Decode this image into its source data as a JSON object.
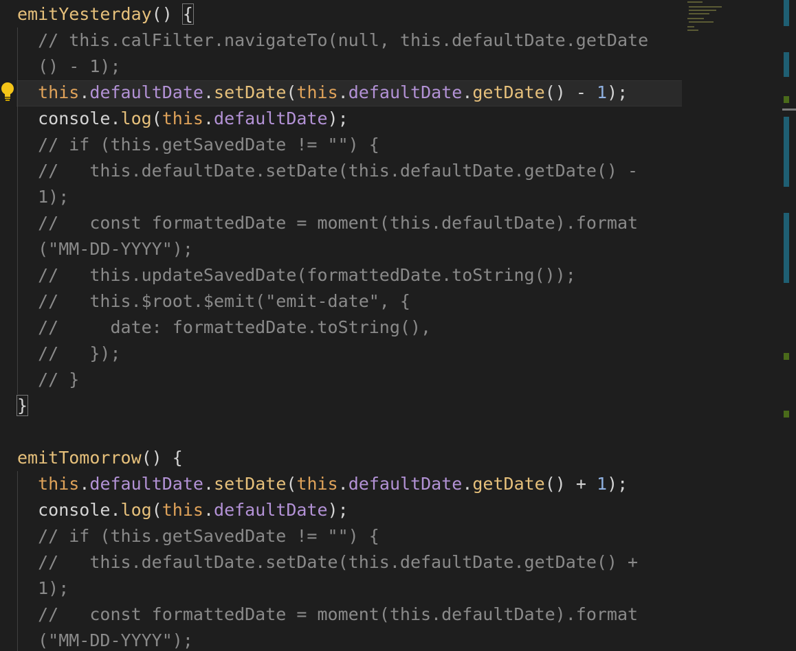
{
  "editor": {
    "theme_colors": {
      "background": "#1e1e1e",
      "function": "#e6c07b",
      "keyword_this": "#e0a35a",
      "property": "#b392d6",
      "number": "#8fb0e0",
      "comment": "#8a8a8a",
      "plain": "#d4d4d4"
    },
    "lightbulb_icon": "lightbulb-icon",
    "lines": [
      {
        "segments": [
          {
            "t": "emitYesterday",
            "c": "fn"
          },
          {
            "t": "() ",
            "c": "plain"
          },
          {
            "t": "{",
            "c": "plain",
            "match": true
          }
        ]
      },
      {
        "segments": [
          {
            "t": "  // this.calFilter.navigateTo(null, this.defaultDate.getDate",
            "c": "comment"
          }
        ]
      },
      {
        "segments": [
          {
            "t": "  () - 1);",
            "c": "comment"
          }
        ]
      },
      {
        "segments": [
          {
            "t": "  ",
            "c": "plain"
          },
          {
            "t": "this",
            "c": "this"
          },
          {
            "t": ".",
            "c": "plain"
          },
          {
            "t": "defaultDate",
            "c": "prop"
          },
          {
            "t": ".",
            "c": "plain"
          },
          {
            "t": "setDate",
            "c": "fn"
          },
          {
            "t": "(",
            "c": "plain"
          },
          {
            "t": "this",
            "c": "this"
          },
          {
            "t": ".",
            "c": "plain"
          },
          {
            "t": "defaultDate",
            "c": "prop"
          },
          {
            "t": ".",
            "c": "plain"
          },
          {
            "t": "getDate",
            "c": "fn"
          },
          {
            "t": "() - ",
            "c": "plain"
          },
          {
            "t": "1",
            "c": "num"
          },
          {
            "t": ");",
            "c": "plain"
          }
        ]
      },
      {
        "segments": [
          {
            "t": "  console.",
            "c": "plain"
          },
          {
            "t": "log",
            "c": "fn"
          },
          {
            "t": "(",
            "c": "plain"
          },
          {
            "t": "this",
            "c": "this"
          },
          {
            "t": ".",
            "c": "plain"
          },
          {
            "t": "defaultDate",
            "c": "prop"
          },
          {
            "t": ");",
            "c": "plain"
          }
        ]
      },
      {
        "segments": [
          {
            "t": "  // if (this.getSavedDate != \"\") {",
            "c": "comment"
          }
        ]
      },
      {
        "segments": [
          {
            "t": "  //   this.defaultDate.setDate(this.defaultDate.getDate() -",
            "c": "comment"
          }
        ]
      },
      {
        "segments": [
          {
            "t": "  1);",
            "c": "comment"
          }
        ]
      },
      {
        "segments": [
          {
            "t": "  //   const formattedDate = moment(this.defaultDate).format",
            "c": "comment"
          }
        ]
      },
      {
        "segments": [
          {
            "t": "  (\"MM-DD-YYYY\");",
            "c": "comment"
          }
        ]
      },
      {
        "segments": [
          {
            "t": "  //   this.updateSavedDate(formattedDate.toString());",
            "c": "comment"
          }
        ]
      },
      {
        "segments": [
          {
            "t": "  //   this.$root.$emit(\"emit-date\", {",
            "c": "comment"
          }
        ]
      },
      {
        "segments": [
          {
            "t": "  //     date: formattedDate.toString(),",
            "c": "comment"
          }
        ]
      },
      {
        "segments": [
          {
            "t": "  //   });",
            "c": "comment"
          }
        ]
      },
      {
        "segments": [
          {
            "t": "  // }",
            "c": "comment"
          }
        ]
      },
      {
        "segments": [
          {
            "t": "}",
            "c": "plain",
            "match": true
          }
        ]
      },
      {
        "segments": []
      },
      {
        "segments": [
          {
            "t": "emitTomorrow",
            "c": "fn"
          },
          {
            "t": "() {",
            "c": "plain"
          }
        ]
      },
      {
        "segments": [
          {
            "t": "  ",
            "c": "plain"
          },
          {
            "t": "this",
            "c": "this"
          },
          {
            "t": ".",
            "c": "plain"
          },
          {
            "t": "defaultDate",
            "c": "prop"
          },
          {
            "t": ".",
            "c": "plain"
          },
          {
            "t": "setDate",
            "c": "fn"
          },
          {
            "t": "(",
            "c": "plain"
          },
          {
            "t": "this",
            "c": "this"
          },
          {
            "t": ".",
            "c": "plain"
          },
          {
            "t": "defaultDate",
            "c": "prop"
          },
          {
            "t": ".",
            "c": "plain"
          },
          {
            "t": "getDate",
            "c": "fn"
          },
          {
            "t": "() + ",
            "c": "plain"
          },
          {
            "t": "1",
            "c": "num"
          },
          {
            "t": ");",
            "c": "plain"
          }
        ]
      },
      {
        "segments": [
          {
            "t": "  console.",
            "c": "plain"
          },
          {
            "t": "log",
            "c": "fn"
          },
          {
            "t": "(",
            "c": "plain"
          },
          {
            "t": "this",
            "c": "this"
          },
          {
            "t": ".",
            "c": "plain"
          },
          {
            "t": "defaultDate",
            "c": "prop"
          },
          {
            "t": ");",
            "c": "plain"
          }
        ]
      },
      {
        "segments": [
          {
            "t": "  // if (this.getSavedDate != \"\") {",
            "c": "comment"
          }
        ]
      },
      {
        "segments": [
          {
            "t": "  //   this.defaultDate.setDate(this.defaultDate.getDate() +",
            "c": "comment"
          }
        ]
      },
      {
        "segments": [
          {
            "t": "  1);",
            "c": "comment"
          }
        ]
      },
      {
        "segments": [
          {
            "t": "  //   const formattedDate = moment(this.defaultDate).format",
            "c": "comment"
          }
        ]
      },
      {
        "segments": [
          {
            "t": "  (\"MM-DD-YYYY\");",
            "c": "comment"
          }
        ]
      }
    ]
  }
}
